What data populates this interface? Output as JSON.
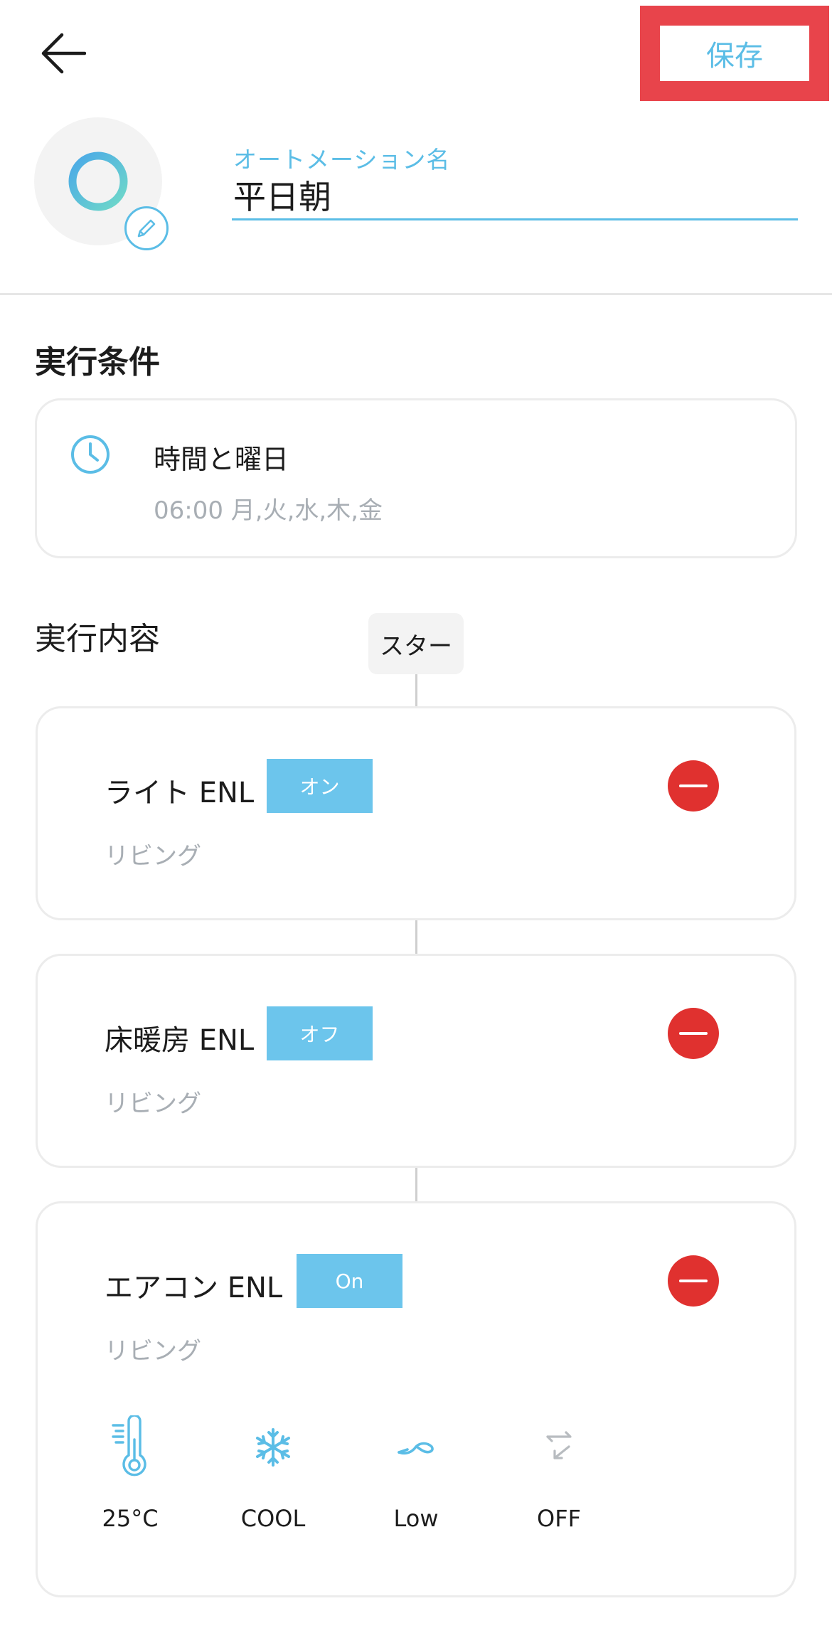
{
  "header": {
    "save_label": "保存"
  },
  "automation": {
    "name_label": "オートメーション名",
    "name_value": "平日朝"
  },
  "conditions": {
    "title": "実行条件",
    "items": [
      {
        "icon": "clock-icon",
        "title": "時間と曜日",
        "subtitle": "06:00  月,火,水,木,金"
      }
    ]
  },
  "actions": {
    "title": "実行内容",
    "start_label": "スター",
    "items": [
      {
        "name": "ライト ENL",
        "state": "オン",
        "room": "リビング"
      },
      {
        "name": "床暖房 ENL",
        "state": "オフ",
        "room": "リビング"
      },
      {
        "name": "エアコン ENL",
        "state": "On",
        "room": "リビング",
        "settings": [
          {
            "icon": "thermometer-icon",
            "label": "25°C"
          },
          {
            "icon": "snowflake-icon",
            "label": "COOL"
          },
          {
            "icon": "fan-speed-icon",
            "label": "Low"
          },
          {
            "icon": "swing-icon",
            "label": "OFF"
          }
        ]
      }
    ]
  },
  "colors": {
    "accent": "#5bbde6",
    "badge": "#6cc5ec",
    "remove": "#e0312f",
    "highlight": "#e8444b",
    "muted_text": "#a8aeb4"
  }
}
